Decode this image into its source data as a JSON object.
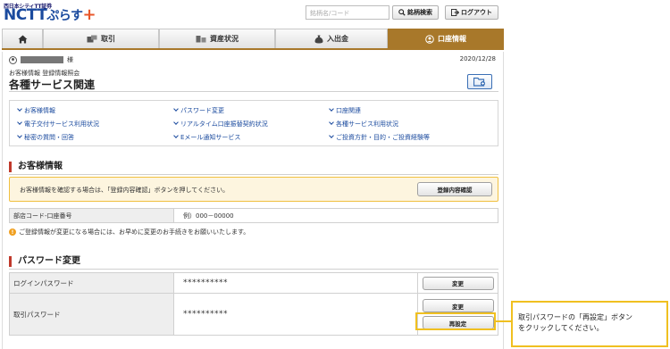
{
  "header": {
    "logo_sub": "西日本シティTT証券",
    "logo_main": "NCTT",
    "logo_kana": "ぷらす",
    "logo_plus": "+",
    "search_placeholder": "銘柄名/コード",
    "search_button": "銘柄検索",
    "logout_button": "ログアウト"
  },
  "nav": {
    "items": [
      {
        "label": "",
        "icon": "home-icon"
      },
      {
        "label": "取引",
        "icon": "trade-icon"
      },
      {
        "label": "資産状況",
        "icon": "asset-icon"
      },
      {
        "label": "入出金",
        "icon": "money-bag-icon"
      },
      {
        "label": "口座情報",
        "icon": "account-icon",
        "active": true
      }
    ]
  },
  "user": {
    "suffix": "様",
    "date": "2020/12/28"
  },
  "breadcrumb": "お客様情報 登録情報照会",
  "page_title": "各種サービス関連",
  "links": [
    "お客様情報",
    "パスワード変更",
    "口座関連",
    "電子交付サービス利用状況",
    "リアルタイム口座振替契約状況",
    "各種サービス利用状況",
    "秘密の質問・回答",
    "Eメール通知サービス",
    "ご投資方針・目的・ご投資経験等"
  ],
  "customer_section": {
    "title": "お客様情報",
    "notice": "お客様情報を確認する場合は、「登録内容確認」ボタンを押してください。",
    "confirm_button": "登録内容確認",
    "table_header": "部店コード-口座番号",
    "table_value": "例）000－00000",
    "warning": "ご登録情報が変更になる場合には、お早めに変更のお手続きをお願いいたします。"
  },
  "password_section": {
    "title": "パスワード変更",
    "rows": [
      {
        "label": "ログインパスワード",
        "value": "**********",
        "buttons": [
          "変更"
        ]
      },
      {
        "label": "取引パスワード",
        "value": "**********",
        "buttons": [
          "変更",
          "再設定"
        ]
      }
    ]
  },
  "callout": {
    "line1": "取引パスワードの「再設定」ボタン",
    "line2": "をクリックしてください。"
  },
  "colors": {
    "accent_gold": "#a8782a",
    "section_red": "#c0392b",
    "link_blue": "#1a4a9e",
    "highlight_yellow": "#f0c020"
  }
}
